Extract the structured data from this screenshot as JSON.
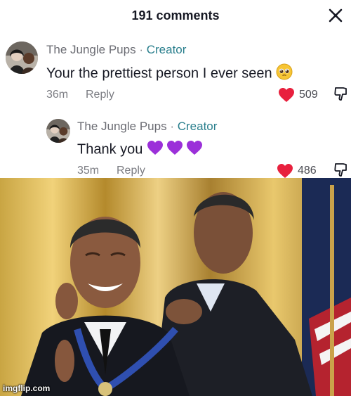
{
  "header": {
    "title": "191 comments",
    "close_icon": "close-icon"
  },
  "comments": [
    {
      "author": "The Jungle Pups",
      "separator": "·",
      "badge": "Creator",
      "text": "Your the prettiest person I ever seen",
      "emoji": "pleading-face-emoji",
      "time": "36m",
      "reply_label": "Reply",
      "likes": "509"
    },
    {
      "author": "The Jungle Pups",
      "separator": "·",
      "badge": "Creator",
      "text": "Thank you",
      "emoji": "purple-hearts-emoji",
      "time": "35m",
      "reply_label": "Reply",
      "likes": "486"
    }
  ],
  "colors": {
    "heart": "#e8203d",
    "creator": "#2a7f8d",
    "purple_heart": "#9b30d9"
  },
  "meme": {
    "watermark": "imgflip.com"
  }
}
